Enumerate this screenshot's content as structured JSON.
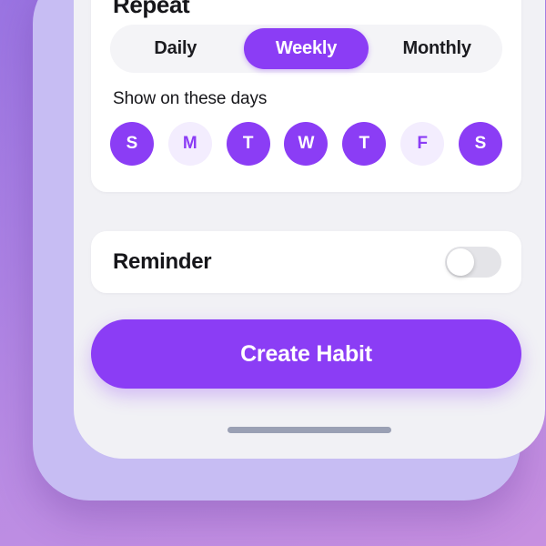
{
  "theme": {
    "accent": "#8b3df5",
    "accent_soft": "#f3edfe",
    "screen_bg": "#f1f1f5",
    "card_bg": "#ffffff",
    "bezel": "#c7bdf3",
    "wallpaper_top": "#9a74e2",
    "wallpaper_bottom": "#c78fe0",
    "toggle_off_track": "#e4e4e8",
    "home_indicator": "#9aa0b4"
  },
  "repeat_card": {
    "title": "Repeat",
    "segmented_control": {
      "selected": "Weekly",
      "options": [
        {
          "label": "Daily",
          "selected": false
        },
        {
          "label": "Weekly",
          "selected": true
        },
        {
          "label": "Monthly",
          "selected": false
        }
      ]
    },
    "days_label": "Show on these days",
    "days": [
      {
        "label": "S",
        "name": "sunday",
        "selected": true
      },
      {
        "label": "M",
        "name": "monday",
        "selected": false
      },
      {
        "label": "T",
        "name": "tuesday",
        "selected": true
      },
      {
        "label": "W",
        "name": "wednesday",
        "selected": true
      },
      {
        "label": "T",
        "name": "thursday",
        "selected": true
      },
      {
        "label": "F",
        "name": "friday",
        "selected": false
      },
      {
        "label": "S",
        "name": "saturday",
        "selected": true
      }
    ]
  },
  "reminder_card": {
    "label": "Reminder",
    "toggle": {
      "state": "off",
      "on": false
    }
  },
  "primary_action": {
    "label": "Create Habit"
  }
}
